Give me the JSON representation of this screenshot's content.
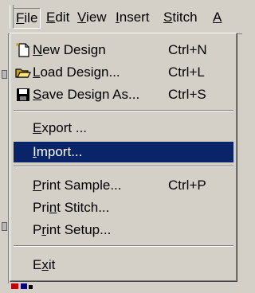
{
  "menubar": {
    "items": [
      {
        "label": "File",
        "u": "F"
      },
      {
        "label": "Edit",
        "u": "E"
      },
      {
        "label": "View",
        "u": "V"
      },
      {
        "label": "Insert",
        "u": "I"
      },
      {
        "label": "Stitch",
        "u": "S"
      },
      {
        "label": "A",
        "u": "A"
      }
    ]
  },
  "file_menu": {
    "items": [
      {
        "pre": "",
        "u": "N",
        "post": "ew Design",
        "shortcut": "Ctrl+N",
        "icon": "new-document-icon"
      },
      {
        "pre": "",
        "u": "L",
        "post": "oad Design...",
        "shortcut": "Ctrl+L",
        "icon": "open-folder-icon"
      },
      {
        "pre": "",
        "u": "S",
        "post": "ave Design As...",
        "shortcut": "Ctrl+S",
        "icon": "save-disk-icon"
      },
      {
        "pre": "",
        "u": "E",
        "post": "xport ...",
        "shortcut": ""
      },
      {
        "pre": "",
        "u": "I",
        "post": "mport...",
        "shortcut": "",
        "highlighted": true
      },
      {
        "pre": "",
        "u": "P",
        "post": "rint Sample...",
        "shortcut": "Ctrl+P"
      },
      {
        "pre": "Pri",
        "u": "n",
        "post": "t Stitch...",
        "shortcut": ""
      },
      {
        "pre": "P",
        "u": "r",
        "post": "int Setup...",
        "shortcut": ""
      },
      {
        "pre": "E",
        "u": "x",
        "post": "it",
        "shortcut": ""
      }
    ]
  },
  "colors": {
    "highlight": "#0a246a",
    "face": "#d4d0c8"
  }
}
